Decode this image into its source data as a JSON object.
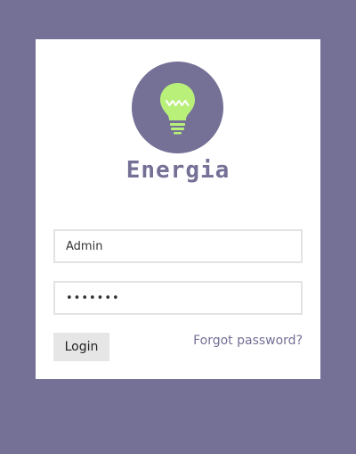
{
  "brand": {
    "name": "Energia",
    "logo_icon": "lightbulb-icon"
  },
  "login": {
    "username_value": "Admin",
    "password_value": "•••••••",
    "login_button": "Login",
    "forgot_link": "Forgot password?"
  },
  "colors": {
    "background": "#747096",
    "card": "#ffffff",
    "accent": "#747096",
    "bulb": "#b8f07a",
    "button_bg": "#e6e6e6"
  }
}
